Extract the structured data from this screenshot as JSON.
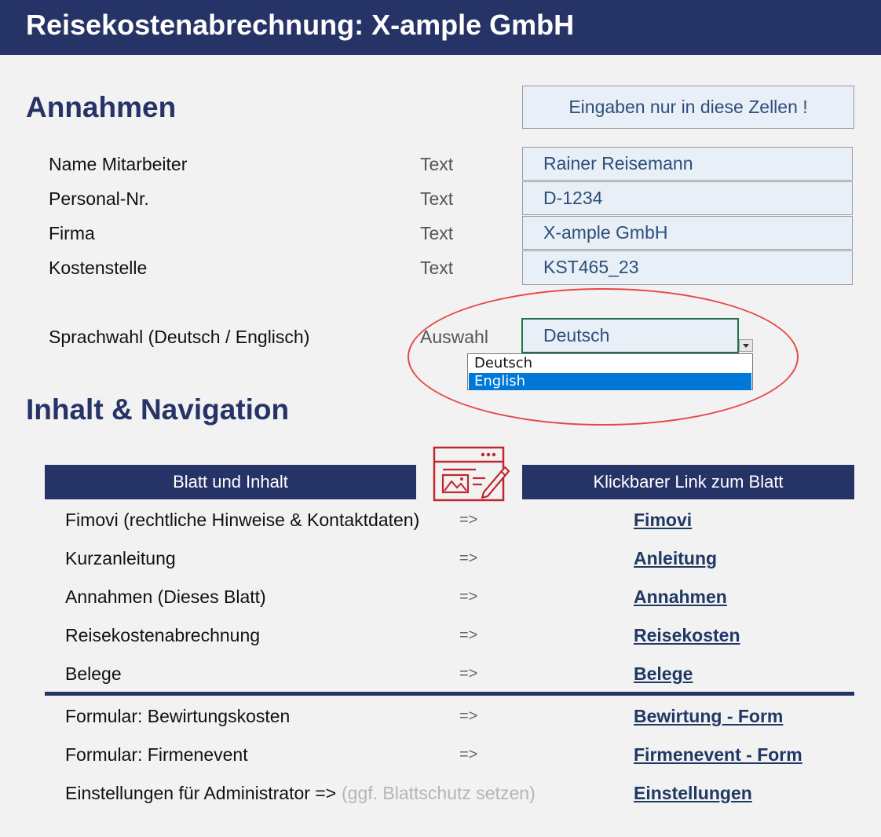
{
  "header": {
    "title": "Reisekostenabrechnung: X-ample GmbH"
  },
  "assumptions": {
    "heading": "Annahmen",
    "hint": "Eingaben nur in diese Zellen !",
    "fields": [
      {
        "label": "Name Mitarbeiter",
        "type": "Text",
        "value": "Rainer Reisemann"
      },
      {
        "label": "Personal-Nr.",
        "type": "Text",
        "value": "D-1234"
      },
      {
        "label": "Firma",
        "type": "Text",
        "value": "X-ample GmbH"
      },
      {
        "label": "Kostenstelle",
        "type": "Text",
        "value": "KST465_23"
      }
    ],
    "language": {
      "label": "Sprachwahl (Deutsch / Englisch)",
      "type": "Auswahl",
      "value": "Deutsch",
      "options": [
        "Deutsch",
        "English"
      ],
      "highlighted": "English"
    }
  },
  "navigation": {
    "heading": "Inhalt & Navigation",
    "col_left": "Blatt und Inhalt",
    "col_right": "Klickbarer Link zum Blatt",
    "arrow": "=>",
    "rows": [
      {
        "label": "Fimovi (rechtliche Hinweise & Kontaktdaten)",
        "link": "Fimovi"
      },
      {
        "label": "Kurzanleitung",
        "link": "Anleitung"
      },
      {
        "label": "Annahmen (Dieses Blatt)",
        "link": "Annahmen"
      },
      {
        "label": "Reisekostenabrechnung",
        "link": "Reisekosten"
      },
      {
        "label": "Belege",
        "link": "Belege"
      },
      {
        "label": "Formular: Bewirtungskosten",
        "link": "Bewirtung - Form"
      },
      {
        "label": "Formular: Firmenevent",
        "link": "Firmenevent - Form"
      }
    ],
    "admin": {
      "label": "Einstellungen für Administrator =>",
      "note": "(ggf. Blattschutz setzen)",
      "link": "Einstellungen"
    }
  },
  "icons": {
    "web_form": "web-form-edit-icon",
    "dropdown": "chevron-down-icon"
  },
  "colors": {
    "header": "#263366",
    "input_bg": "#e9eff7",
    "input_text": "#2c4f7c",
    "ellipse": "#e84747",
    "selection": "#0078d7",
    "icon": "#c0262d"
  }
}
